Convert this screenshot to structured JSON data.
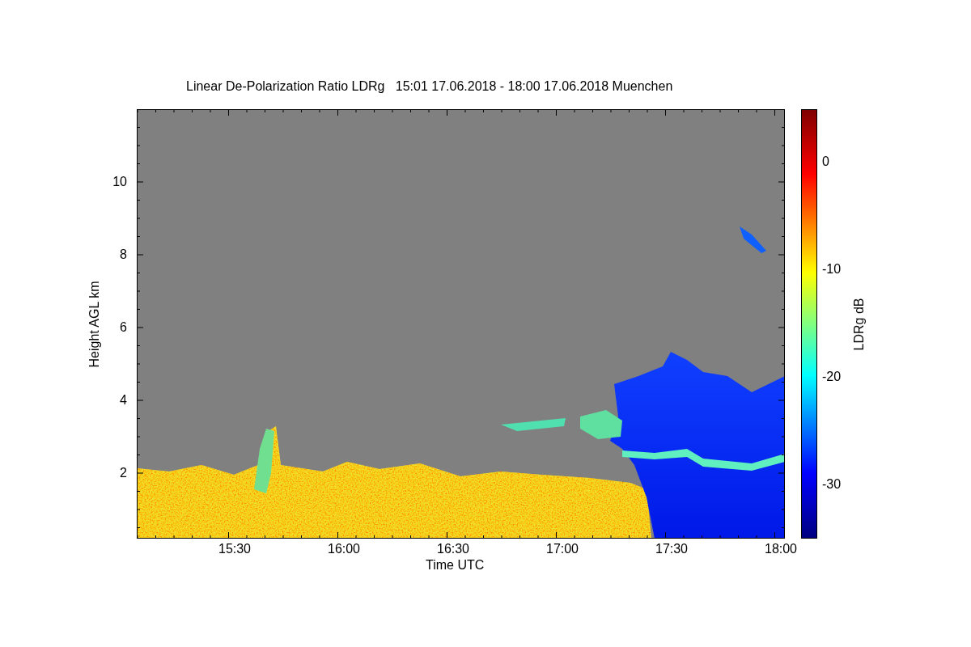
{
  "title": "Linear De-Polarization Ratio LDRg   15:01 17.06.2018 - 18:00 17.06.2018 Muenchen",
  "y_axis": {
    "label": "Height AGL km",
    "ticks": [
      "10",
      "8",
      "6",
      "4",
      "2"
    ]
  },
  "x_axis": {
    "label": "Time UTC",
    "ticks": [
      "15:30",
      "16:00",
      "16:30",
      "17:00",
      "17:30",
      "18:00"
    ]
  },
  "colorbar": {
    "label": "LDRg dB",
    "ticks": [
      "0",
      "-10",
      "-20",
      "-30"
    ]
  }
}
